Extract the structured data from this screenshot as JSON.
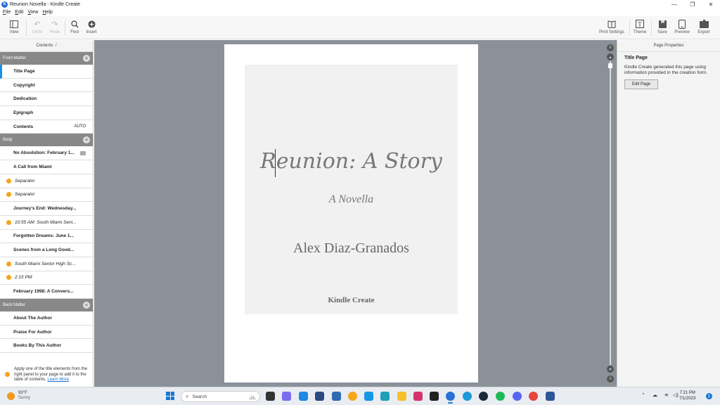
{
  "window": {
    "title": "Reunion Novella - Kindle Create",
    "app_icon": "k",
    "controls": [
      "—",
      "❐",
      "✕"
    ]
  },
  "menu": [
    {
      "label": "File",
      "key": "F",
      "rest": "ile"
    },
    {
      "label": "Edit",
      "key": "E",
      "rest": "dit"
    },
    {
      "label": "View",
      "key": "V",
      "rest": "iew"
    },
    {
      "label": "Help",
      "key": "H",
      "rest": "elp"
    }
  ],
  "toolbar": {
    "view": {
      "icon": "view-icon",
      "label": "View"
    },
    "undo": {
      "icon": "undo-icon",
      "label": "Undo"
    },
    "redo": {
      "icon": "redo-icon",
      "label": "Redo"
    },
    "find": {
      "icon": "search-icon",
      "label": "Find"
    },
    "insert": {
      "icon": "plus-circle-icon",
      "label": "Insert"
    },
    "print_settings": {
      "icon": "book-icon",
      "label": "Print Settings"
    },
    "theme": {
      "icon": "theme-icon",
      "label": "Theme"
    },
    "save": {
      "icon": "save-icon",
      "label": "Save"
    },
    "preview": {
      "icon": "tablet-icon",
      "label": "Preview"
    },
    "export": {
      "icon": "export-icon",
      "label": "Export"
    }
  },
  "contents": {
    "header": "Contents",
    "header_suffix": "/",
    "front_matter": {
      "label": "Front Matter",
      "items": [
        {
          "label": "Title Page",
          "selected": true
        },
        {
          "label": "Copyright"
        },
        {
          "label": "Dedication"
        },
        {
          "label": "Epigraph"
        },
        {
          "label": "Contents",
          "right": "AUTO"
        }
      ]
    },
    "body": {
      "label": "Body",
      "items": [
        {
          "label": "No Absolution: February 1...",
          "badge": true
        },
        {
          "label": "A Call from Miami"
        },
        {
          "label": "Separator",
          "separator": true
        },
        {
          "label": "Separator",
          "separator": true
        },
        {
          "label": "Journey's End: Wednesday..."
        },
        {
          "label": "10:55 AM: South Miami Seni...",
          "separator": true
        },
        {
          "label": "Forgotten Dreams: June 1..."
        },
        {
          "label": "Scenes from a Long Good..."
        },
        {
          "label": "South Miami Senior High Sc...",
          "separator": true
        },
        {
          "label": "2:15 PM:",
          "separator": true
        },
        {
          "label": "February 1998: A Convers..."
        }
      ]
    },
    "back_matter": {
      "label": "Back Matter",
      "items": [
        {
          "label": "About The Author"
        },
        {
          "label": "Praise For Author"
        },
        {
          "label": "Books By This Author"
        }
      ]
    },
    "hint": "Apply one of the title elements from the right panel to your page to add it to the table of contents.",
    "hint_link": "Learn More"
  },
  "page": {
    "title": "Reunion: A Story",
    "subtitle": "A Novella",
    "author": "Alex Diaz-Granados",
    "publisher": "Kindle Create"
  },
  "properties": {
    "header": "Page Properties",
    "title": "Title Page",
    "description": "Kindle Create generated this page using information provided in the creation form.",
    "button": "Edit Page"
  },
  "taskbar": {
    "weather_temp": "93°F",
    "weather_cond": "Sunny",
    "search_placeholder": "Search",
    "time": "7:21 PM",
    "date": "7/1/2023",
    "notifications": "1"
  },
  "colors": {
    "accent": "#1a8fe8",
    "canvas": "#8a9199",
    "section_header": "#888888",
    "separator_dot": "#f4a51c"
  }
}
